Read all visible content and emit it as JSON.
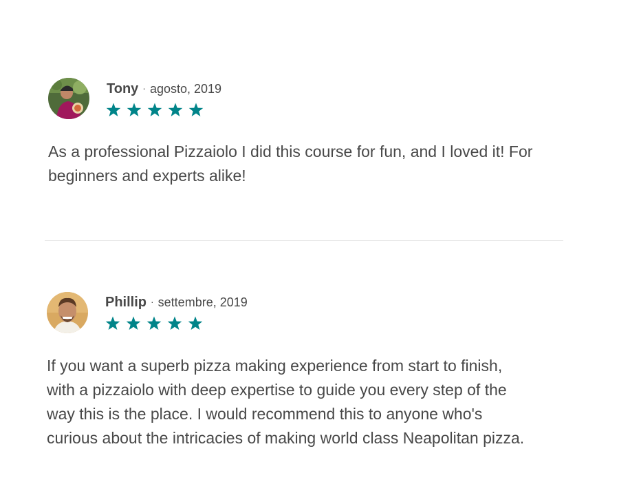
{
  "reviews": [
    {
      "name": "Tony",
      "separator": "·",
      "date": "agosto, 2019",
      "rating": 5,
      "text_lines": [
        "As a professional Pizzaiolo I did this course for fun, and I loved it! For",
        "beginners and experts alike!"
      ]
    },
    {
      "name": "Phillip",
      "separator": "·",
      "date": "settembre, 2019",
      "rating": 5,
      "text_lines": [
        "If you want a superb pizza making experience from start to finish,",
        "with a pizzaiolo with deep expertise to guide you every step of the",
        "way this is the place. I would recommend this to anyone who's",
        "curious about the intricacies of making world class Neapolitan pizza."
      ]
    }
  ],
  "colors": {
    "star": "#008489",
    "text": "#484848",
    "divider": "#e4e4e4"
  }
}
